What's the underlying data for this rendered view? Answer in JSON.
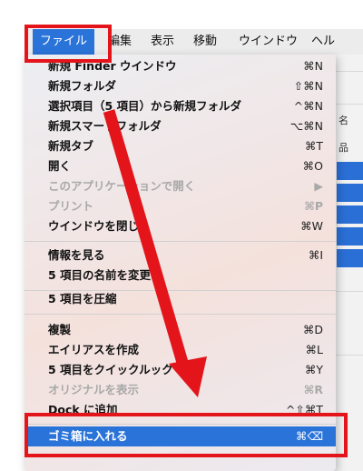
{
  "menubar": {
    "items": [
      {
        "label": "ファイル"
      },
      {
        "label": "編集"
      },
      {
        "label": "表示"
      },
      {
        "label": "移動"
      },
      {
        "label": "ウインドウ"
      },
      {
        "label": "ヘル"
      }
    ]
  },
  "menu": {
    "items": [
      {
        "label": "新規 Finder ウインドウ",
        "shortcut": "⌘N"
      },
      {
        "label": "新規フォルダ",
        "shortcut": "⇧⌘N"
      },
      {
        "label": "選択項目（5 項目）から新規フォルダ",
        "shortcut": "^⌘N"
      },
      {
        "label": "新規スマートフォルダ",
        "shortcut": "⌥⌘N"
      },
      {
        "label": "新規タブ",
        "shortcut": "⌘T"
      },
      {
        "label": "開く",
        "shortcut": "⌘O"
      },
      {
        "label": "このアプリケーションで開く",
        "shortcut": "▶"
      },
      {
        "label": "プリント",
        "shortcut": "⌘P"
      },
      {
        "label": "ウインドウを閉じる",
        "shortcut": "⌘W"
      },
      {
        "label": "情報を見る",
        "shortcut": "⌘I"
      },
      {
        "label": "5 項目の名前を変更...",
        "shortcut": ""
      },
      {
        "label": "5 項目を圧縮",
        "shortcut": ""
      },
      {
        "label": "複製",
        "shortcut": "⌘D"
      },
      {
        "label": "エイリアスを作成",
        "shortcut": "⌘L"
      },
      {
        "label": "5 項目をクイックルック",
        "shortcut": "⌘Y"
      },
      {
        "label": "オリジナルを表示",
        "shortcut": "⌘R"
      },
      {
        "label": "Dock に追加",
        "shortcut": "^⇧⌘T"
      },
      {
        "label": "ゴミ箱に入れる",
        "shortcut": "⌘⌫"
      }
    ]
  },
  "background": {
    "glyph_a": "名",
    "glyph_b": "品"
  },
  "colors": {
    "highlight": "#2a74d9",
    "annotation_red": "#e3151a"
  }
}
